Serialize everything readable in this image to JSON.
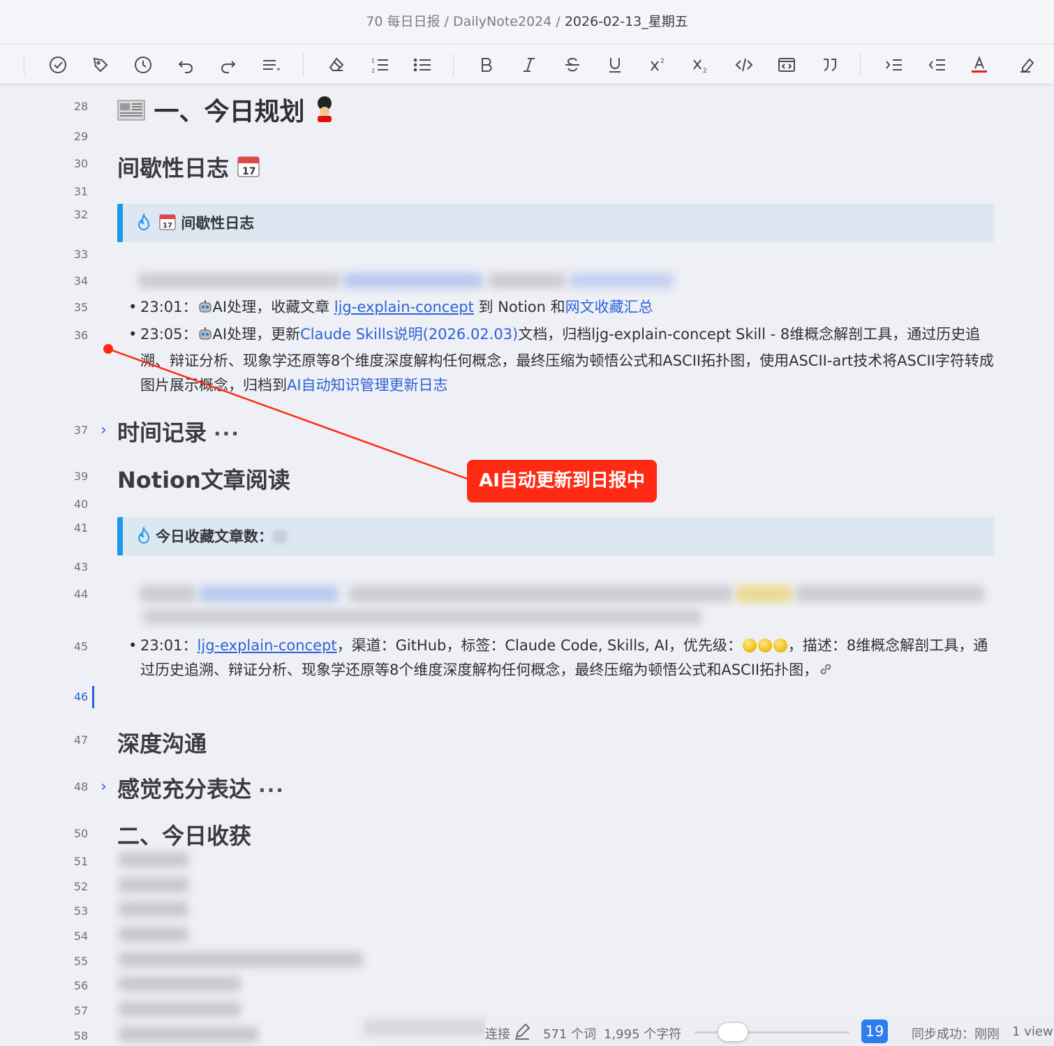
{
  "breadcrumb": {
    "part1": "70 每日日报",
    "sep1": " / ",
    "part2": "DailyNote2024",
    "sep2": " / ",
    "current": "2026-02-13_星期五"
  },
  "toolbar": {
    "icons": [
      "task-check-icon",
      "pen-tag-icon",
      "clock-icon",
      "undo-icon",
      "redo-icon",
      "align-icon",
      "eraser-icon",
      "ordered-list-icon",
      "bullet-list-icon",
      "bold-icon",
      "italic-icon",
      "strikethrough-icon",
      "underline-icon",
      "superscript-icon",
      "subscript-icon",
      "code-icon",
      "code-block-icon",
      "quote-icon",
      "indent-icon",
      "outdent-icon",
      "text-color-icon",
      "highlight-icon"
    ]
  },
  "lines": {
    "n28": "28",
    "n29": "29",
    "n30": "30",
    "n31": "31",
    "n32": "32",
    "n33": "33",
    "n34": "34",
    "n35": "35",
    "n36": "36",
    "n37": "37",
    "n39": "39",
    "n40": "40",
    "n41": "41",
    "n43": "43",
    "n44": "44",
    "n45": "45",
    "n46": "46",
    "n47": "47",
    "n48": "48",
    "n50": "50",
    "n51": "51",
    "n52": "52",
    "n53": "53",
    "n54": "54",
    "n55": "55",
    "n56": "56",
    "n57": "57",
    "n58": "58"
  },
  "content": {
    "h_plan": "一、今日规划",
    "h_journal": "间歇性日志",
    "callout_journal": "间歇性日志",
    "item35": {
      "time": "23:01：",
      "pre": "AI处理，收藏文章 ",
      "link1": "ljg-explain-concept",
      "mid": " 到 Notion 和",
      "link2": "网文收藏汇总"
    },
    "item36": {
      "time": "23:05：",
      "pre": "AI处理，更新",
      "link1": "Claude Skills说明(2026.02.03)",
      "mid": "文档，归档ljg-explain-concept Skill - 8维概念解剖工具，通过历史追溯、辩证分析、现象学还原等8个维度深度解构任何概念，最终压缩为顿悟公式和ASCII拓扑图，使用ASCII-art技术将ASCII字符转成图片展示概念，归档到",
      "link2": "AI自动知识管理更新日志"
    },
    "h_time": "时间记录",
    "h_notion": "Notion文章阅读",
    "callout_count": "今日收藏文章数：",
    "item45": {
      "time": "23:01：",
      "link": "ljg-explain-concept",
      "rest1": "，渠道：GitHub，标签：Claude Code, Skills, AI，优先级：",
      "rest2": "，描述：8维概念解剖工具，通过历史追溯、辩证分析、现象学还原等8个维度深度解构任何概念，最终压缩为顿悟公式和ASCII拓扑图，"
    },
    "h_deep": "深度沟通",
    "h_feel": "感觉充分表达",
    "h_gain": "二、今日收获",
    "more": "···"
  },
  "annotation": {
    "label": "AI自动更新到日报中",
    "color": "#ff2a14"
  },
  "status": {
    "frag": "连接",
    "words": "571 个词",
    "chars": "1,995 个字符",
    "badge": "19",
    "sync": "同步成功：刚刚",
    "views": "1 view"
  },
  "colors": {
    "accent": "#2a62d8",
    "link": "#2b62d9",
    "callout_bg": "#dce7f1",
    "callout_bar": "#1f9ae8"
  }
}
